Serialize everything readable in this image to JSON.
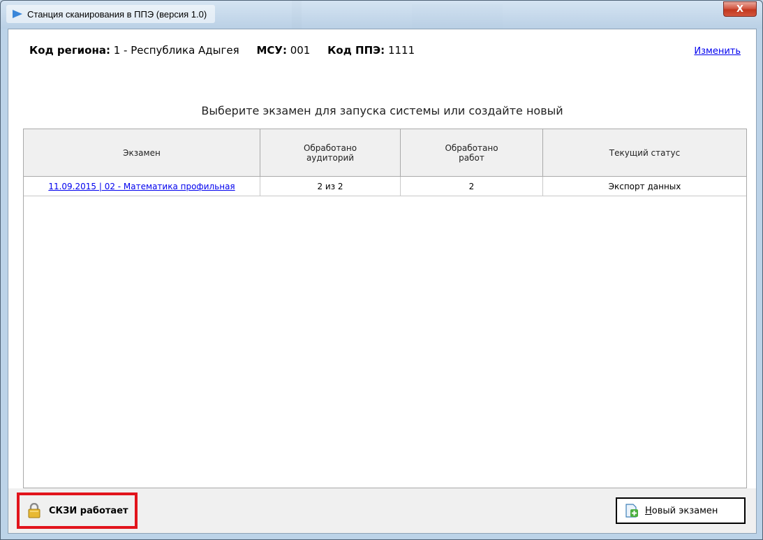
{
  "window": {
    "title": "Станция сканирования в ППЭ (версия 1.0)",
    "close_label": "X"
  },
  "header": {
    "region_label": "Код региона:",
    "region_value": "1 - Республика Адыгея",
    "msu_label": "МСУ:",
    "msu_value": "001",
    "ppe_label": "Код ППЭ:",
    "ppe_value": "1111",
    "change_link": "Изменить"
  },
  "subtitle": "Выберите экзамен для запуска системы или создайте новый",
  "table": {
    "columns": [
      {
        "line1": "Экзамен",
        "line2": ""
      },
      {
        "line1": "Обработано",
        "line2": "аудиторий"
      },
      {
        "line1": "Обработано",
        "line2": "работ"
      },
      {
        "line1": "Текущий статус",
        "line2": ""
      }
    ],
    "rows": [
      {
        "exam": "11.09.2015 | 02 - Математика профильная",
        "rooms": "2 из 2",
        "works": "2",
        "status": "Экспорт данных"
      }
    ]
  },
  "footer": {
    "skzi_status": "СКЗИ работает",
    "new_exam_hotkey": "Н",
    "new_exam_rest": "овый экзамен"
  },
  "colors": {
    "highlight_border": "#e2141c",
    "link": "#0000ee",
    "close_button": "#c2381f"
  },
  "icons": {
    "title": "scanner-app-icon",
    "skzi": "padlock-icon",
    "new_exam": "add-document-icon"
  }
}
